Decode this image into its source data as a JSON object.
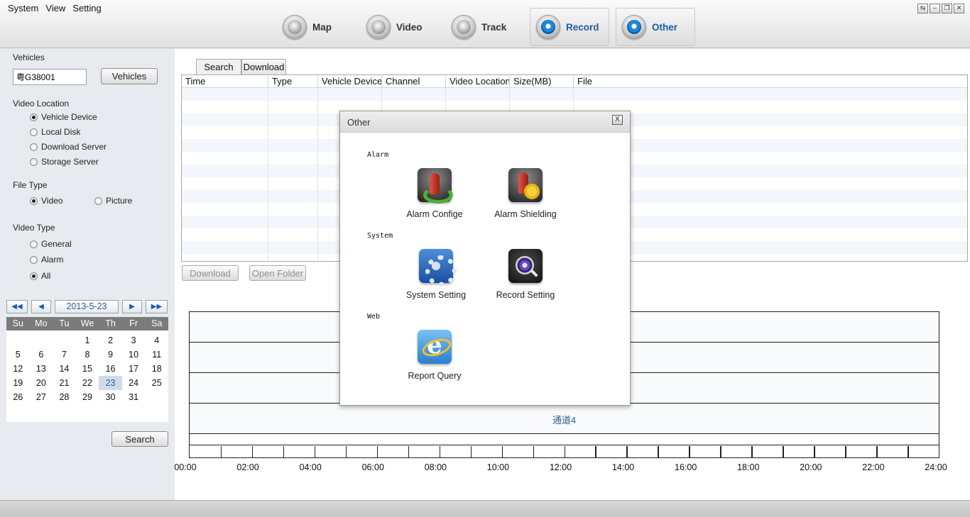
{
  "menu": [
    "System",
    "View",
    "Setting"
  ],
  "nav": [
    {
      "label": "Map",
      "icon": "map-globe-icon"
    },
    {
      "label": "Video",
      "icon": "video-camera-icon"
    },
    {
      "label": "Track",
      "icon": "track-icon"
    },
    {
      "label": "Record",
      "icon": "record-camera-icon",
      "active": true
    },
    {
      "label": "Other",
      "icon": "other-settings-icon",
      "active": true
    }
  ],
  "left": {
    "vehicles_title": "Vehicles",
    "vehicle_value": "粤G38001",
    "vehicles_button": "Vehicles",
    "video_location_title": "Video Location",
    "video_location_options": [
      "Vehicle Device",
      "Local Disk",
      "Download Server",
      "Storage Server"
    ],
    "video_location_selected": 0,
    "file_type_title": "File Type",
    "file_type_options": [
      "Video",
      "Picture"
    ],
    "file_type_selected": 0,
    "video_type_title": "Video Type",
    "video_type_options": [
      "General",
      "Alarm",
      "All"
    ],
    "video_type_selected": 2,
    "search_button": "Search"
  },
  "calendar": {
    "month_label": "2013-5-23",
    "weekdays": [
      "Su",
      "Mo",
      "Tu",
      "We",
      "Th",
      "Fr",
      "Sa"
    ],
    "first_weekday": 3,
    "days": 31,
    "selected_day": 23
  },
  "main": {
    "tabs": [
      "Search",
      "Download"
    ],
    "columns": [
      "Time",
      "Type",
      "Vehicle Device",
      "Channel",
      "Video Location",
      "Size(MB)",
      "File"
    ],
    "download_button": "Download",
    "open_folder_button": "Open Folder",
    "timeline_lane_label": "通道4",
    "timeline_hours": [
      "00:00",
      "02:00",
      "04:00",
      "06:00",
      "08:00",
      "10:00",
      "12:00",
      "14:00",
      "16:00",
      "18:00",
      "20:00",
      "22:00",
      "24:00"
    ]
  },
  "modal": {
    "title": "Other",
    "close_label": "X",
    "sections": [
      {
        "name": "Alarm",
        "items": [
          {
            "label": "Alarm Confige",
            "icon": "alarm-config-icon"
          },
          {
            "label": "Alarm Shielding",
            "icon": "alarm-shielding-icon"
          }
        ]
      },
      {
        "name": "System",
        "items": [
          {
            "label": "System Setting",
            "icon": "system-setting-icon"
          },
          {
            "label": "Record Setting",
            "icon": "record-setting-icon"
          }
        ]
      },
      {
        "name": "Web",
        "items": [
          {
            "label": "Report Query",
            "icon": "report-query-icon"
          }
        ]
      }
    ]
  },
  "window_controls": [
    "⇆",
    "–",
    "❐",
    "✕"
  ]
}
